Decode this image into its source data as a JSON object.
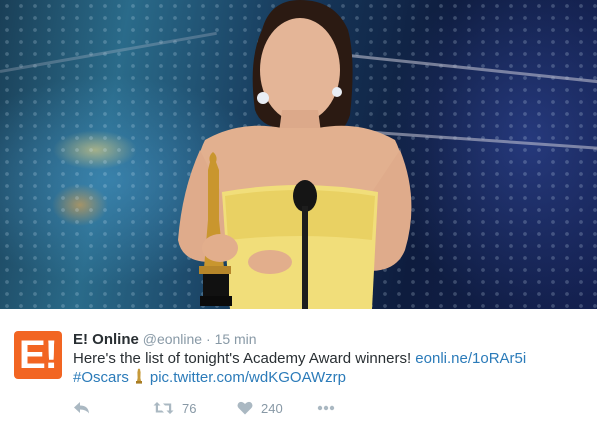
{
  "tweet": {
    "display_name": "E! Online",
    "handle": "@eonline",
    "separator": "·",
    "timestamp": "15 min",
    "avatar_letter": "E!",
    "text_main": "Here's the list of tonight's Academy Award winners!",
    "link_url": "eonli.ne/1oRAr5i",
    "hashtag": "#Oscars",
    "pic_link": "pic.twitter.com/wdKGOAWzrp",
    "retweet_count": "76",
    "like_count": "240"
  },
  "icons": {
    "reply": "reply-icon",
    "retweet": "retweet-icon",
    "like": "heart-icon",
    "more": "more-icon",
    "oscar": "oscar-statuette-icon"
  },
  "colors": {
    "avatar_bg": "#f26522",
    "link": "#2b7bb9",
    "muted": "#8899a6",
    "text": "#292f33"
  }
}
